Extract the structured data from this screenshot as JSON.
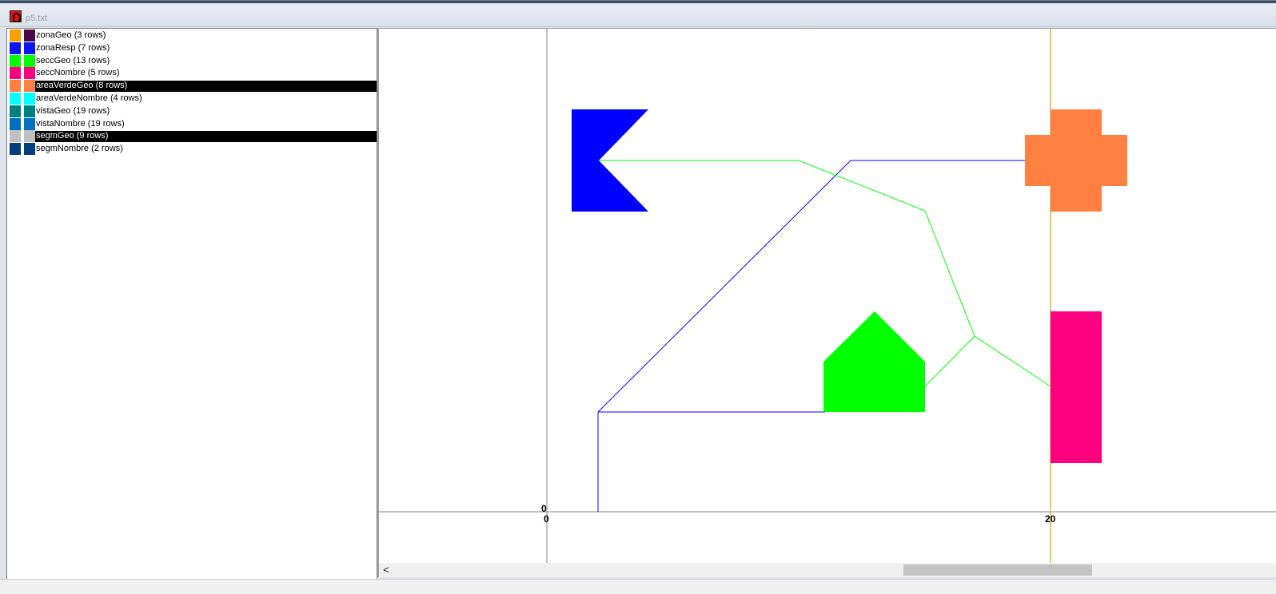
{
  "window": {
    "title": "p5.txt"
  },
  "layers": [
    {
      "label": "zonaGeo (3 rows)",
      "color1": "#f5a000",
      "color2": "#4a0a48",
      "selected": false
    },
    {
      "label": "zonaResp (7 rows)",
      "color1": "#0a14f0",
      "color2": "#0a14f0",
      "selected": false
    },
    {
      "label": "seccGeo (13 rows)",
      "color1": "#00ff00",
      "color2": "#00ff00",
      "selected": false
    },
    {
      "label": "seccNombre (5 rows)",
      "color1": "#ff0080",
      "color2": "#ff0080",
      "selected": false
    },
    {
      "label": "areaVerdeGeo (8 rows)",
      "color1": "#ff8040",
      "color2": "#ff8040",
      "selected": true
    },
    {
      "label": "areaVerdeNombre (4 rows)",
      "color1": "#00ffff",
      "color2": "#00ffff",
      "selected": false
    },
    {
      "label": "vistaGeo (19 rows)",
      "color1": "#008080",
      "color2": "#008080",
      "selected": false
    },
    {
      "label": "vistaNombre (19 rows)",
      "color1": "#0070c0",
      "color2": "#0070c0",
      "selected": false
    },
    {
      "label": "segmGeo (9 rows)",
      "color1": "#c0c0c0",
      "color2": "#c0c0c0",
      "selected": true
    },
    {
      "label": "segmNombre (2 rows)",
      "color1": "#003f7f",
      "color2": "#003f7f",
      "selected": false
    }
  ],
  "map": {
    "x_axis_label_origin": "0",
    "x_axis_label_20": "20",
    "y_axis_label_origin": "0",
    "colors": {
      "flag": "#0000ff",
      "cross": "#ff8040",
      "house": "#00ff00",
      "bar": "#ff0080",
      "blue_line": "#0000ff",
      "green_line": "#00ff00",
      "axis": "#808080",
      "guide": "#d4b838"
    }
  },
  "icons": {
    "app": "app-icon",
    "scroll_left": "chevron-left-icon"
  },
  "scrollbar": {
    "left_arrow": "<"
  }
}
